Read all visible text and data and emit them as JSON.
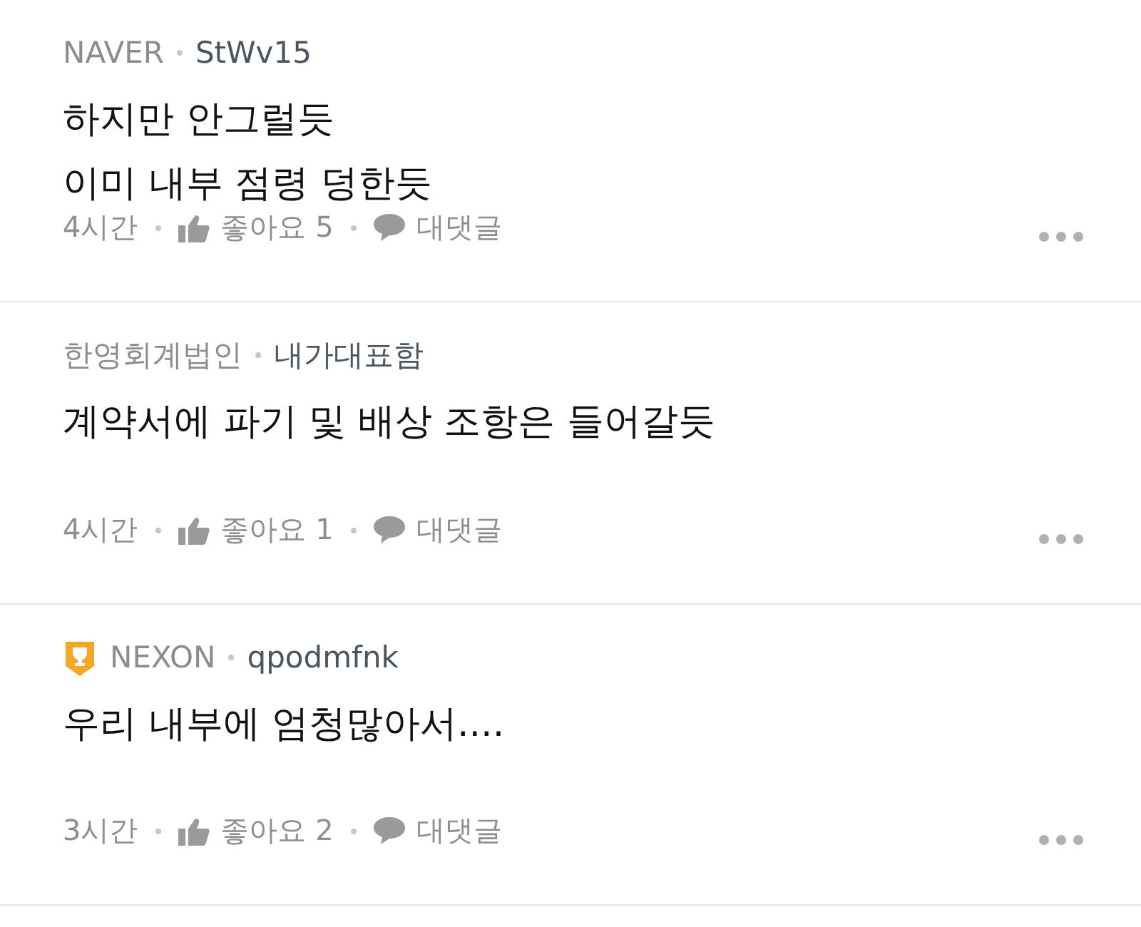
{
  "comments": [
    {
      "kind": "plain",
      "company": "NAVER",
      "author": "StWv15",
      "lines": [
        "하지만 안그럴듯",
        "이미 내부 점령 덩한듯"
      ],
      "time": "4시간",
      "likes": "좋아요 5",
      "reply": "대댓글"
    },
    {
      "kind": "plain",
      "company": "한영회계법인",
      "author": "내가대표함",
      "lines": [
        "계약서에 파기 및 배상 조항은 들어갈듯"
      ],
      "time": "4시간",
      "likes": "좋아요 1",
      "reply": "대댓글"
    },
    {
      "kind": "trophy",
      "company": "NEXON",
      "author": "qpodmfnk",
      "lines": [
        "우리 내부에 엄청많아서...."
      ],
      "time": "3시간",
      "likes": "좋아요 2",
      "reply": "대댓글"
    }
  ]
}
